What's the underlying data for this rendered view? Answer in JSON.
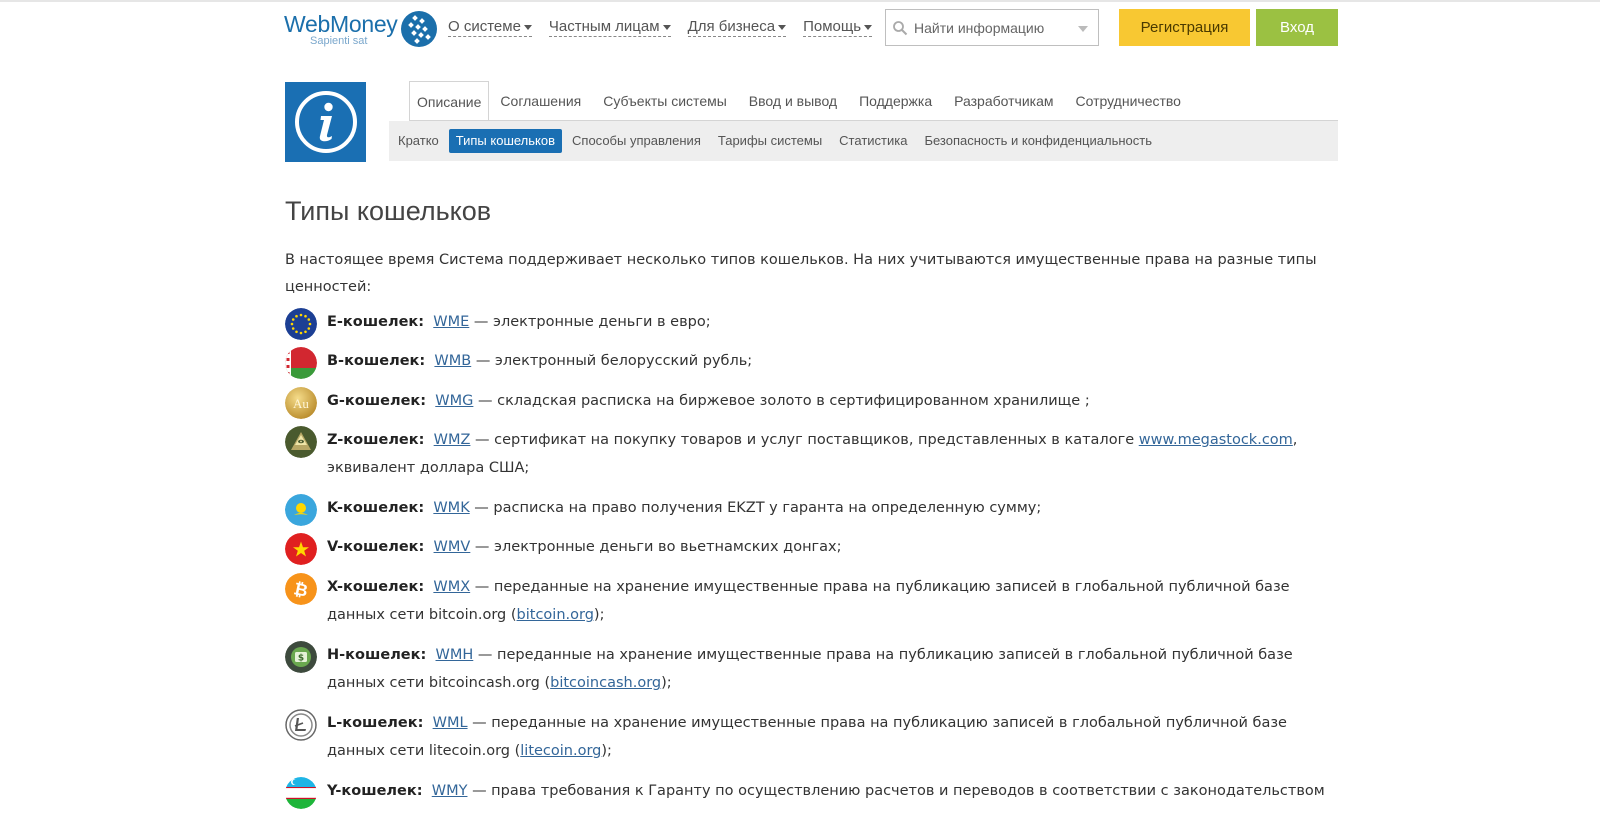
{
  "header": {
    "logo_text": "WebMoney",
    "logo_sub": "Sapienti sat",
    "nav": [
      "О системе",
      "Частным лицам",
      "Для бизнеса",
      "Помощь"
    ],
    "search_placeholder": "Найти информацию",
    "register_label": "Регистрация",
    "login_label": "Вход"
  },
  "tabs": [
    "Описание",
    "Соглашения",
    "Субъекты системы",
    "Ввод и вывод",
    "Поддержка",
    "Разработчикам",
    "Сотрудничество"
  ],
  "subnav": [
    "Кратко",
    "Типы кошельков",
    "Способы управления",
    "Тарифы системы",
    "Статистика",
    "Безопасность и конфиденциальность"
  ],
  "content": {
    "title": "Типы кошельков",
    "intro": "В настоящее время Система поддерживает несколько типов кошельков. На них учитываются имущественные права на разные типы ценностей:",
    "wallets": [
      {
        "name": "E-кошелек:",
        "code": "WME",
        "desc": " — электронные деньги в евро;",
        "icon": "eu-flag-icon",
        "color": "#1c3f94"
      },
      {
        "name": "B-кошелек:",
        "code": "WMB",
        "desc": " — электронный белорусский рубль;",
        "icon": "belarus-flag-icon",
        "color": "#d22730"
      },
      {
        "name": "G-кошелек:",
        "code": "WMG",
        "desc": " — складская расписка на биржевое золото в сертифицированном хранилище ;",
        "icon": "gold-au-icon",
        "color": "#d4a73a"
      },
      {
        "name": "Z-кошелек:",
        "code": "WMZ",
        "desc": " — сертификат на покупку товаров и услуг поставщиков, представленных в каталоге ",
        "link": "www.megastock.com",
        "desc2": ", эквивалент доллара США;",
        "icon": "pyramid-eye-icon",
        "color": "#6b6b3a"
      },
      {
        "name": "K-кошелек:",
        "code": "WMK",
        "desc": " — расписка на право получения EKZT у гаранта на определенную сумму;",
        "icon": "kazakhstan-flag-icon",
        "color": "#3aa6dd"
      },
      {
        "name": "V-кошелек:",
        "code": "WMV",
        "desc": " — электронные деньги во вьетнамских донгах;",
        "icon": "vietnam-flag-icon",
        "color": "#e02020"
      },
      {
        "name": "X-кошелек:",
        "code": "WMX",
        "desc": " — переданные на хранение имущественные права на публикацию записей в глобальной публичной базе данных сети bitcoin.org (",
        "link": "bitcoin.org",
        "desc2": ");",
        "icon": "bitcoin-icon",
        "color": "#f7931a"
      },
      {
        "name": "H-кошелек:",
        "code": "WMH",
        "desc": " — переданные на хранение имущественные права на публикацию записей в глобальной публичной базе данных сети bitcoincash.org (",
        "link": "bitcoincash.org",
        "desc2": ");",
        "icon": "bitcoincash-icon",
        "color": "#3d5c3d"
      },
      {
        "name": "L-кошелек:",
        "code": "WML",
        "desc": " — переданные на хранение имущественные права на публикацию записей в глобальной публичной базе данных сети litecoin.org (",
        "link": "litecoin.org",
        "desc2": ");",
        "icon": "litecoin-icon",
        "color": "#ffffff"
      },
      {
        "name": "Y-кошелек:",
        "code": "WMY",
        "desc": " — права требования к Гаранту по осуществлению расчетов и переводов в соответствии с законодательством",
        "icon": "uzbekistan-flag-icon",
        "color": "#1eb53a"
      }
    ]
  }
}
